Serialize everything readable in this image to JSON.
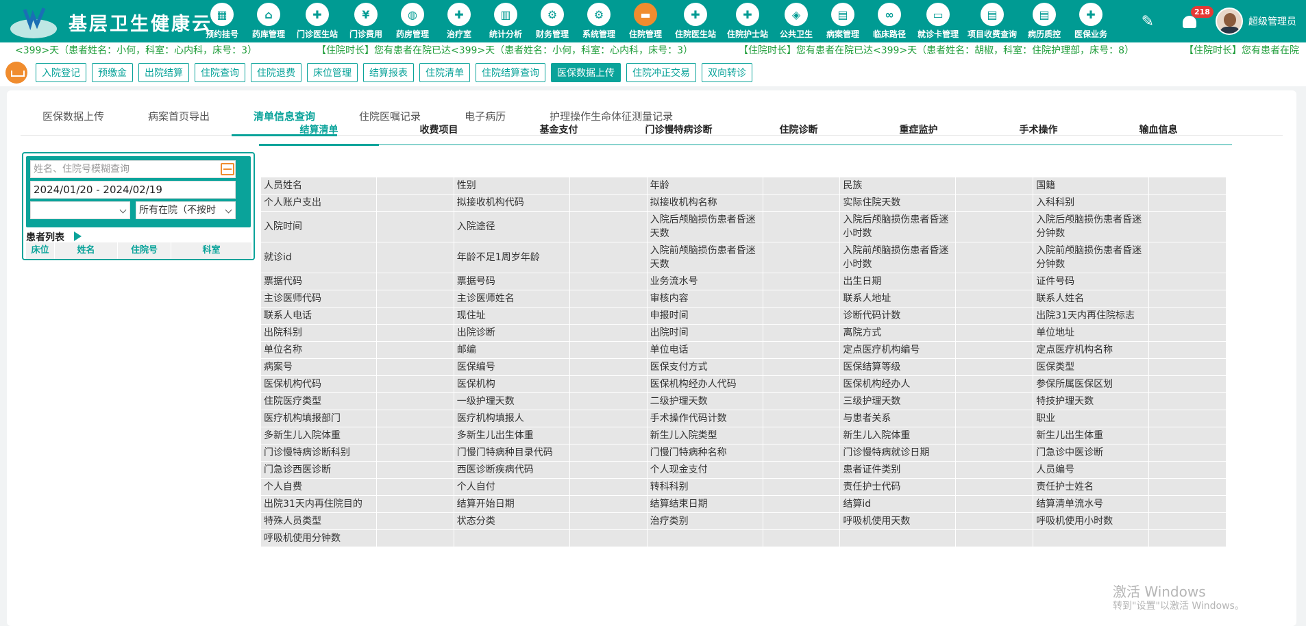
{
  "app": {
    "title": "基层卫生健康云",
    "user_name": "超级管理员",
    "notification_count": "218",
    "accent_color": "#009b93",
    "active_color": "#f08c2e"
  },
  "nav": [
    {
      "label": "预约挂号",
      "icon": "calendar-icon",
      "glyph": "▦"
    },
    {
      "label": "药库管理",
      "icon": "home-icon",
      "glyph": "⌂"
    },
    {
      "label": "门诊医生站",
      "icon": "doctor-icon",
      "glyph": "✚"
    },
    {
      "label": "门诊费用",
      "icon": "yen-icon",
      "glyph": "¥"
    },
    {
      "label": "药房管理",
      "icon": "pill-icon",
      "glyph": "◍"
    },
    {
      "label": "治疗室",
      "icon": "nurse-icon",
      "glyph": "✚"
    },
    {
      "label": "统计分析",
      "icon": "chart-icon",
      "glyph": "▥"
    },
    {
      "label": "财务管理",
      "icon": "finance-icon",
      "glyph": "⚙"
    },
    {
      "label": "系统管理",
      "icon": "gear-icon",
      "glyph": "⚙"
    },
    {
      "label": "住院管理",
      "icon": "bed-icon",
      "glyph": "▬"
    },
    {
      "label": "住院医生站",
      "icon": "doctor-icon",
      "glyph": "✚"
    },
    {
      "label": "住院护士站",
      "icon": "nurse-icon",
      "glyph": "✚"
    },
    {
      "label": "公共卫生",
      "icon": "public-health-icon",
      "glyph": "◈"
    },
    {
      "label": "病案管理",
      "icon": "record-icon",
      "glyph": "▤"
    },
    {
      "label": "临床路径",
      "icon": "path-icon",
      "glyph": "∞"
    },
    {
      "label": "就诊卡管理",
      "icon": "card-icon",
      "glyph": "▭"
    },
    {
      "label": "项目收费查询",
      "icon": "search-fee-icon",
      "glyph": "▤"
    },
    {
      "label": "病历质控",
      "icon": "quality-icon",
      "glyph": "▤"
    },
    {
      "label": "医保业务",
      "icon": "insurance-icon",
      "glyph": "✚"
    }
  ],
  "marquee": [
    "<399>天（患者姓名：小何，科室：心内科，床号：3）",
    "【住院时长】您有患者在院已达<399>天（患者姓名：小何，科室：心内科，床号：3）",
    "【住院时长】您有患者在院已达<399>天（患者姓名：胡椒，科室：住院护理部，床号：8）",
    "【住院时长】您有患者在院"
  ],
  "actions": [
    "入院登记",
    "预缴金",
    "出院结算",
    "住院查询",
    "住院退费",
    "床位管理",
    "结算报表",
    "住院清单",
    "住院结算查询",
    "医保数据上传",
    "住院冲正交易",
    "双向转诊"
  ],
  "active_action": "医保数据上传",
  "tabs": [
    "医保数据上传",
    "病案首页导出",
    "清单信息查询",
    "住院医嘱记录",
    "电子病历",
    "护理操作生命体征测量记录"
  ],
  "active_tab": "清单信息查询",
  "patient_panel": {
    "search_placeholder": "姓名、住院号模糊查询",
    "date_range": "2024/01/20 - 2024/02/19",
    "status_select": "所有在院（不按时",
    "list_title": "患者列表",
    "columns": [
      "床位",
      "姓名",
      "住院号",
      "科室"
    ]
  },
  "subtabs": [
    "结算清单",
    "收费项目",
    "基金支付",
    "门诊慢特病诊断",
    "住院诊断",
    "重症监护",
    "手术操作",
    "输血信息"
  ],
  "active_subtab": "结算清单",
  "grid_rows": [
    [
      "人员姓名",
      "性别",
      "年龄",
      "民族",
      "国籍"
    ],
    [
      "个人账户支出",
      "拟接收机构代码",
      "拟接收机构名称",
      "实际住院天数",
      "入科科别"
    ],
    [
      "入院时间",
      "入院途径",
      "入院后颅脑损伤患者昏迷天数",
      "入院后颅脑损伤患者昏迷小时数",
      "入院后颅脑损伤患者昏迷分钟数"
    ],
    [
      "就诊id",
      "年龄不足1周岁年龄",
      "入院前颅脑损伤患者昏迷天数",
      "入院前颅脑损伤患者昏迷小时数",
      "入院前颅脑损伤患者昏迷分钟数"
    ],
    [
      "票据代码",
      "票据号码",
      "业务流水号",
      "出生日期",
      "证件号码"
    ],
    [
      "主诊医师代码",
      "主诊医师姓名",
      "审核内容",
      "联系人地址",
      "联系人姓名"
    ],
    [
      "联系人电话",
      "现住址",
      "申报时间",
      "诊断代码计数",
      "出院31天内再住院标志"
    ],
    [
      "出院科别",
      "出院诊断",
      "出院时间",
      "离院方式",
      "单位地址"
    ],
    [
      "单位名称",
      "邮编",
      "单位电话",
      "定点医疗机构编号",
      "定点医疗机构名称"
    ],
    [
      "病案号",
      "医保编号",
      "医保支付方式",
      "医保结算等级",
      "医保类型"
    ],
    [
      "医保机构代码",
      "医保机构",
      "医保机构经办人代码",
      "医保机构经办人",
      "参保所属医保区划"
    ],
    [
      "住院医疗类型",
      "一级护理天数",
      "二级护理天数",
      "三级护理天数",
      "特技护理天数"
    ],
    [
      "医疗机构填报部门",
      "医疗机构填报人",
      "手术操作代码计数",
      "与患者关系",
      "职业"
    ],
    [
      "多新生儿入院体重",
      "多新生儿出生体重",
      "新生儿入院类型",
      "新生儿入院体重",
      "新生儿出生体重"
    ],
    [
      "门诊慢特病诊断科别",
      "门慢门特病种目录代码",
      "门慢门特病种名称",
      "门诊慢特病就诊日期",
      "门急诊中医诊断"
    ],
    [
      "门急诊西医诊断",
      "西医诊断疾病代码",
      "个人现金支付",
      "患者证件类别",
      "人员编号"
    ],
    [
      "个人自费",
      "个人自付",
      "转科科别",
      "责任护士代码",
      "责任护士姓名"
    ],
    [
      "出院31天内再住院目的",
      "结算开始日期",
      "结算结束日期",
      "结算id",
      "结算清单流水号"
    ],
    [
      "特殊人员类型",
      "状态分类",
      "治疗类别",
      "呼吸机使用天数",
      "呼吸机使用小时数"
    ],
    [
      "呼吸机使用分钟数",
      "",
      "",
      "",
      ""
    ]
  ],
  "watermark": {
    "line1": "激活 Windows",
    "line2": "转到\"设置\"以激活 Windows。"
  }
}
